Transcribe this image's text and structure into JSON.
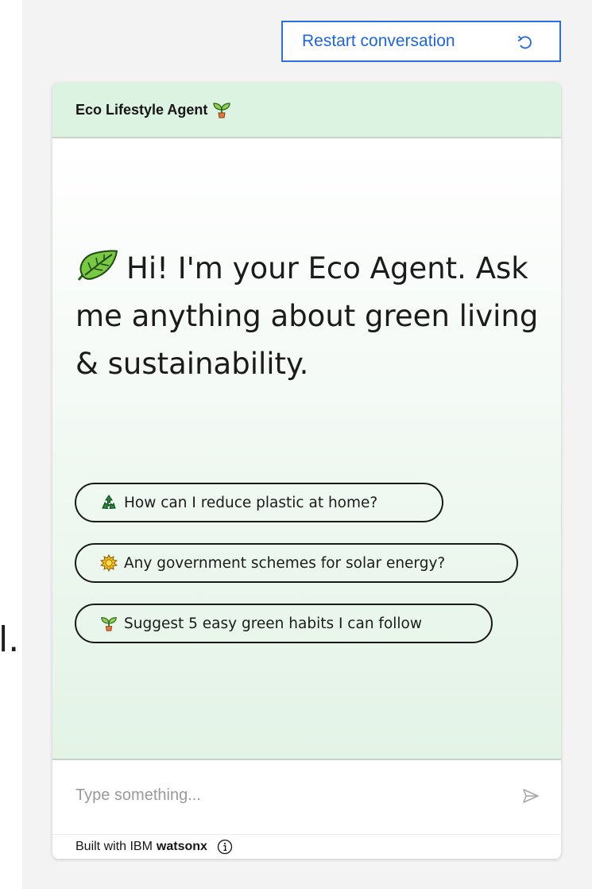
{
  "page": {
    "background_fragment": "l."
  },
  "toolbar": {
    "restart_label": "Restart conversation",
    "restart_icon": "restart-icon"
  },
  "chat": {
    "title": "Eco Lifestyle Agent",
    "title_icon": "sprout-icon",
    "greeting": "Hi! I'm your Eco Agent. Ask me anything about green living & sustainability.",
    "greeting_icon": "leaf-icon",
    "suggestions": [
      {
        "icon": "recycle-icon",
        "label": "How can I reduce plastic at home?"
      },
      {
        "icon": "sun-icon",
        "label": "Any government schemes for solar energy?"
      },
      {
        "icon": "sprout-icon",
        "label": "Suggest 5 easy green habits I can follow"
      }
    ],
    "input_placeholder": "Type something...",
    "send_icon": "send-icon"
  },
  "footer": {
    "built_with": "Built with IBM",
    "brand": "watsonx",
    "info_icon": "info-icon"
  },
  "colors": {
    "accent_blue": "#1c64e8",
    "header_green": "#ddf3e1",
    "chat_gradient_end": "#e3f3e6",
    "page_background": "#f2f3f2"
  }
}
